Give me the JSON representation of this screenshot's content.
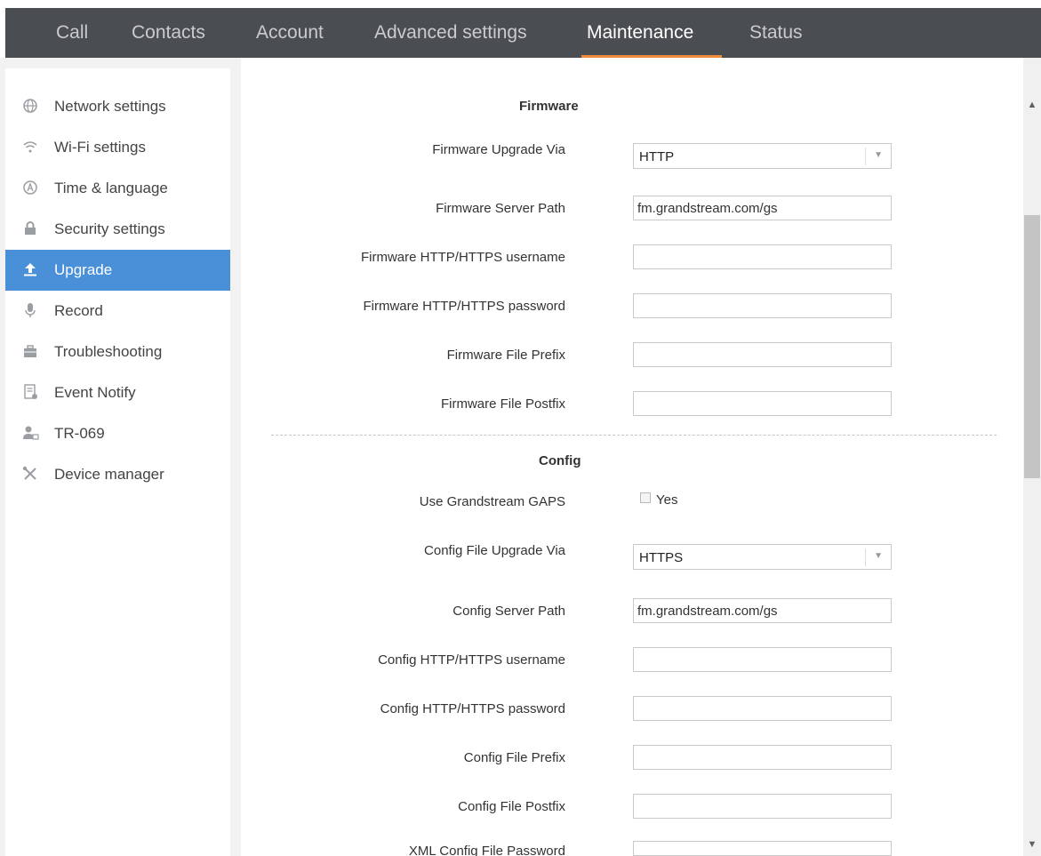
{
  "nav": {
    "tabs": [
      {
        "label": "Call"
      },
      {
        "label": "Contacts"
      },
      {
        "label": "Account"
      },
      {
        "label": "Advanced settings"
      },
      {
        "label": "Maintenance"
      },
      {
        "label": "Status"
      }
    ],
    "active": "Maintenance"
  },
  "sidebar": {
    "items": [
      {
        "label": "Network settings",
        "icon": "globe-icon"
      },
      {
        "label": "Wi-Fi settings",
        "icon": "wifi-icon"
      },
      {
        "label": "Time & language",
        "icon": "time-language-icon"
      },
      {
        "label": "Security settings",
        "icon": "lock-icon"
      },
      {
        "label": "Upgrade",
        "icon": "upload-icon"
      },
      {
        "label": "Record",
        "icon": "microphone-icon"
      },
      {
        "label": "Troubleshooting",
        "icon": "toolbox-icon"
      },
      {
        "label": "Event Notify",
        "icon": "document-icon"
      },
      {
        "label": "TR-069",
        "icon": "user-monitor-icon"
      },
      {
        "label": "Device manager",
        "icon": "tools-icon"
      }
    ],
    "active": "Upgrade"
  },
  "firmware": {
    "title": "Firmware",
    "upgrade_via_label": "Firmware Upgrade Via",
    "upgrade_via_value": "HTTP",
    "server_path_label": "Firmware Server Path",
    "server_path_value": "fm.grandstream.com/gs",
    "username_label": "Firmware HTTP/HTTPS username",
    "username_value": "",
    "password_label": "Firmware HTTP/HTTPS password",
    "password_value": "",
    "prefix_label": "Firmware File Prefix",
    "prefix_value": "",
    "postfix_label": "Firmware File Postfix",
    "postfix_value": ""
  },
  "config": {
    "title": "Config",
    "gaps_label": "Use Grandstream GAPS",
    "gaps_option": "Yes",
    "gaps_checked": false,
    "upgrade_via_label": "Config File Upgrade Via",
    "upgrade_via_value": "HTTPS",
    "server_path_label": "Config Server Path",
    "server_path_value": "fm.grandstream.com/gs",
    "username_label": "Config HTTP/HTTPS username",
    "username_value": "",
    "password_label": "Config HTTP/HTTPS password",
    "password_value": "",
    "prefix_label": "Config File Prefix",
    "prefix_value": "",
    "postfix_label": "Config File Postfix",
    "postfix_value": "",
    "xml_password_label": "XML Config File Password",
    "xml_password_value": ""
  },
  "colors": {
    "nav_bg": "#4a4d52",
    "active_tab_underline": "#f08c3c",
    "sidebar_active": "#4a90d9"
  }
}
